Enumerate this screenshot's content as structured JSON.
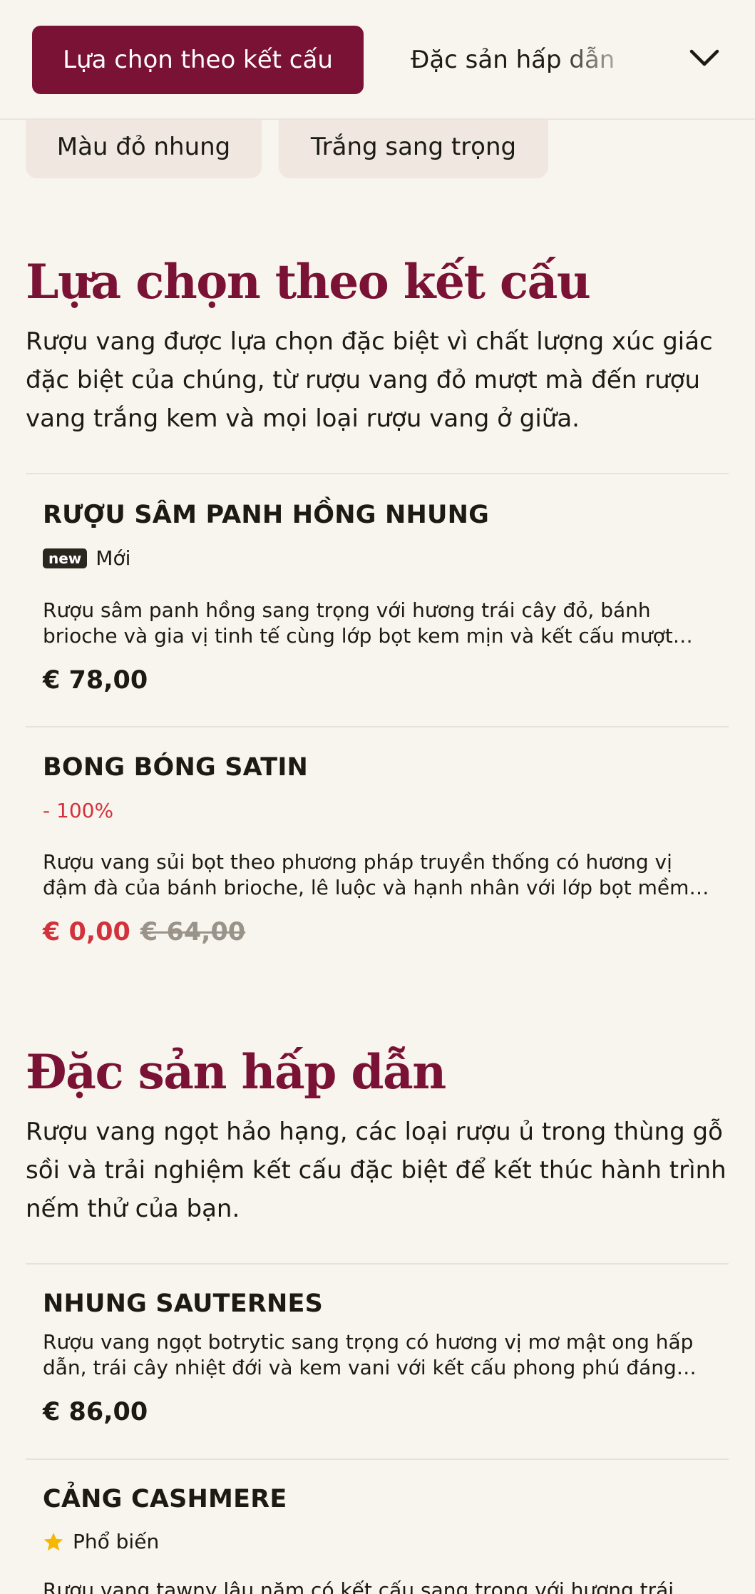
{
  "topbar": {
    "active_category": "Lựa chọn theo kết cấu",
    "next_category": "Đặc sản hấp dẫn"
  },
  "chips": [
    {
      "label": "Màu đỏ nhung"
    },
    {
      "label": "Trắng sang trọng"
    }
  ],
  "sections": [
    {
      "title": "Lựa chọn theo kết cấu",
      "description": "Rượu vang được lựa chọn đặc biệt vì chất lượng xúc giác đặc biệt của chúng, từ rượu vang đỏ mượt mà đến rượu vang trắng kem và mọi loại rượu vang ở giữa.",
      "items": [
        {
          "name": "RƯỢU SÂM PANH HỒNG NHUNG",
          "badge": "new",
          "badge_label": "Mới",
          "description": "Rượu sâm panh hồng sang trọng với hương trái cây đỏ, bánh brioche và gia vị tinh tế cùng lớp bọt kem mịn và kết cấu mượt mà.",
          "price": "€ 78,00"
        },
        {
          "name": "BONG BÓNG SATIN",
          "discount": "- 100%",
          "description": "Rượu vang sủi bọt theo phương pháp truyền thống có hương vị đậm đà của bánh brioche, lê luộc và hạnh nhân với lớp bọt mềm mại.",
          "price": "€ 0,00",
          "old_price": "€ 64,00"
        }
      ]
    },
    {
      "title": "Đặc sản hấp dẫn",
      "description": "Rượu vang ngọt hảo hạng, các loại rượu ủ trong thùng gỗ sồi và trải nghiệm kết cấu đặc biệt để kết thúc hành trình nếm thử của bạn.",
      "items": [
        {
          "name": "NHUNG SAUTERNES",
          "description": "Rượu vang ngọt botrytic sang trọng có hương vị mơ mật ong hấp dẫn, trái cây nhiệt đới và kem vani với kết cấu phong phú đáng nhớ.",
          "price": "€ 86,00"
        },
        {
          "name": "CẢNG CASHMERE",
          "badge_label": "Phổ biến",
          "description": "Rượu vang tawny lâu năm có kết cấu sang trọng với hương trái"
        }
      ]
    }
  ],
  "colors": {
    "brand": "#7a1235",
    "background": "#f8f4ee",
    "chip": "#efe7e0",
    "sale": "#d2323c",
    "star": "#f5b800"
  },
  "icons": {
    "dropdown": "chevron-down-icon",
    "popular": "star-icon"
  }
}
